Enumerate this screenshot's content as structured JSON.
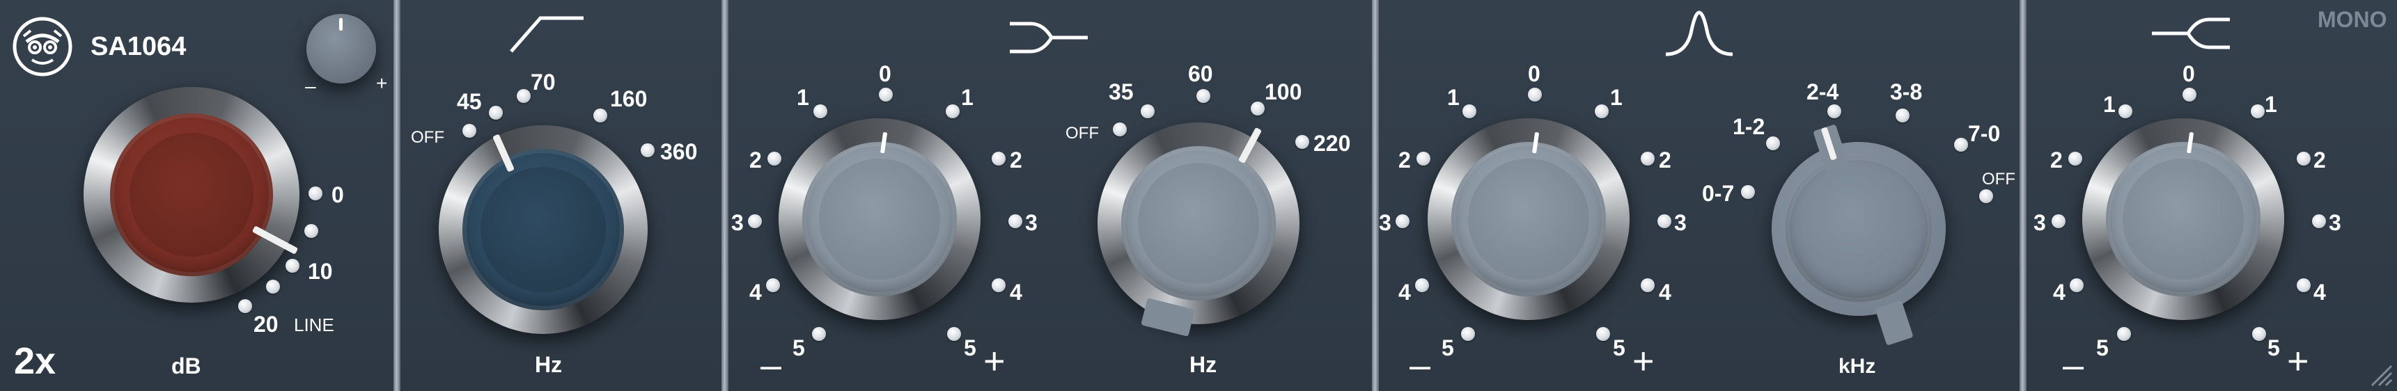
{
  "plugin": {
    "model": "SA1064",
    "mode": "MONO",
    "oversampling": "2x",
    "logo_icon": "robot-face-icon",
    "colors": {
      "panel": "#2f3a46",
      "gain_knob": "#7a2f25",
      "hp_knob": "#2d4457",
      "eq_knob": "#8a96a3",
      "text": "#ffffff"
    }
  },
  "input": {
    "trim_minus": "–",
    "trim_plus": "+",
    "gain_scale": [
      "0",
      "10",
      "20"
    ],
    "line_label": "LINE",
    "unit": "dB"
  },
  "highpass": {
    "icon": "highpass-filter-icon",
    "off_label": "OFF",
    "scale": [
      "45",
      "70",
      "160",
      "360"
    ],
    "unit": "Hz"
  },
  "low_band": {
    "icon": "low-shelf-icon",
    "gain_scale_top": "0",
    "gain_scale_left": [
      "1",
      "2",
      "3",
      "4",
      "5"
    ],
    "gain_scale_right": [
      "1",
      "2",
      "3",
      "4",
      "5"
    ],
    "minus": "–",
    "plus": "+",
    "freq_off_label": "OFF",
    "freq_scale": [
      "35",
      "60",
      "100",
      "220"
    ],
    "freq_unit": "Hz"
  },
  "mid_band": {
    "icon": "bell-curve-icon",
    "gain_scale_top": "0",
    "gain_scale_left": [
      "1",
      "2",
      "3",
      "4",
      "5"
    ],
    "gain_scale_right": [
      "1",
      "2",
      "3",
      "4",
      "5"
    ],
    "minus": "–",
    "plus": "+",
    "freq_scale": [
      "0-7",
      "1-2",
      "2-4",
      "3-8",
      "7-0"
    ],
    "freq_off_label": "OFF",
    "freq_unit": "kHz"
  },
  "high_band": {
    "icon": "high-shelf-icon",
    "gain_scale_top": "0",
    "gain_scale_left": [
      "1",
      "2",
      "3",
      "4",
      "5"
    ],
    "gain_scale_right": [
      "1",
      "2",
      "3",
      "4",
      "5"
    ],
    "minus": "–",
    "plus": "+"
  }
}
